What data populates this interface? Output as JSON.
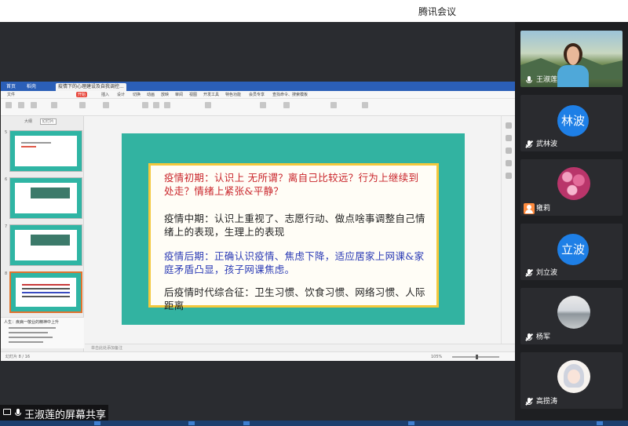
{
  "meeting": {
    "title": "腾讯会议",
    "share_label": "王淑莲的屏幕共享"
  },
  "wps": {
    "tabs": [
      "首页",
      "稻壳",
      "疫情下的心理建设及自我调控..."
    ],
    "menu": [
      "文件",
      "开始",
      "插入",
      "设计",
      "切换",
      "动画",
      "放映",
      "审阅",
      "视图",
      "开发工具",
      "特色功能",
      "会员专享",
      "查找命令、搜索模板"
    ],
    "active_menu": "开始",
    "pane_tabs": [
      "大纲",
      "幻灯片"
    ],
    "notes_placeholder": "单击此处添加备注",
    "status_left": "幻灯片 8 / 16",
    "status_zoom": "105%",
    "notes_preview_title": "人生：疾病一敬业的精神中上升",
    "thumb_numbers": [
      "5",
      "6",
      "7",
      "8"
    ]
  },
  "slide": {
    "paragraphs": [
      "疫情初期：认识上 无所谓？离自己比较远？行为上继续到处走？情绪上紧张&平静？",
      "疫情中期：认识上重视了、志愿行动、做点啥事调整自己情绪上的表现，生理上的表现",
      "疫情后期：正确认识疫情、焦虑下降，适应居家上网课&家庭矛盾凸显，孩子网课焦虑。",
      "后疫情时代综合征：卫生习惯、饮食习惯、网络习惯、人际距离"
    ],
    "colors": {
      "background": "#32b3a1",
      "border": "#f4c83c",
      "p1": "#c9242a",
      "p3": "#2b3bb5"
    }
  },
  "participants": [
    {
      "name": "王淑莲",
      "avatar_type": "video",
      "mic": "on"
    },
    {
      "name": "武林波",
      "avatar_type": "initials",
      "initials": "林波",
      "mic": "muted"
    },
    {
      "name": "雍莉",
      "avatar_type": "flowers",
      "mic": "host-badge"
    },
    {
      "name": "刘立波",
      "avatar_type": "initials",
      "initials": "立波",
      "mic": "muted"
    },
    {
      "name": "杨军",
      "avatar_type": "photo",
      "mic": "muted"
    },
    {
      "name": "高揽涛",
      "avatar_type": "anime",
      "mic": "muted"
    }
  ]
}
